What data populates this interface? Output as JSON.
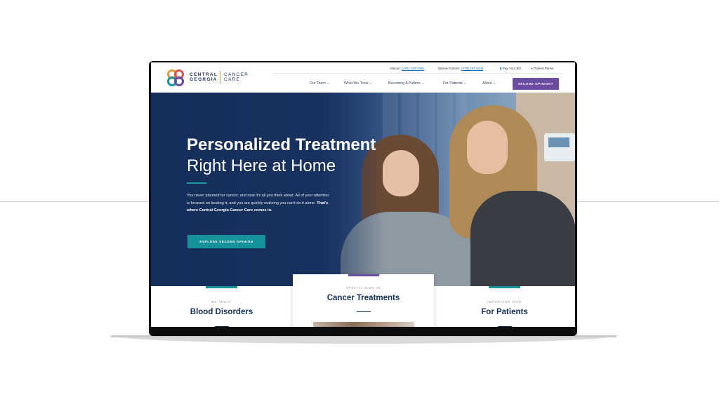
{
  "brand": {
    "name_line1": "CENTRAL",
    "name_line2": "GEORGIA",
    "sub_line1": "CANCER",
    "sub_line2": "CARE",
    "colors": {
      "navy": "#1b2f57",
      "teal": "#16929b",
      "purple": "#6a4ca0",
      "orange": "#e09a3c"
    }
  },
  "topbar": {
    "macon_label": "Macon:",
    "macon_phone": "(478) 743-7068",
    "warner_label": "Warner Robins:",
    "warner_phone": "(478) 287-6344",
    "pay_bill": "Pay Your Bill",
    "patient_portal": "Patient Portal",
    "pay_icon": "card-icon",
    "portal_icon": "user-icon"
  },
  "nav": {
    "items": [
      {
        "label": "Our Team"
      },
      {
        "label": "What We Treat"
      },
      {
        "label": "Becoming A Patient"
      },
      {
        "label": "For Patients"
      },
      {
        "label": "About"
      }
    ],
    "caret": "⌄",
    "cta": "SECOND OPINION?"
  },
  "hero": {
    "title": "Personalized Treatment",
    "subtitle": "Right Here at Home",
    "body_plain": "You never planned for cancer, and now it's all you think about. All of your attention is focused on beating it, and you are quickly realizing you can't do it alone. ",
    "body_bold": "That's where Central Georgia Cancer Care comes in.",
    "button": "EXPLORE SECOND OPINION"
  },
  "cards": [
    {
      "eyebrow": "WE TREAT",
      "title": "Blood Disorders"
    },
    {
      "eyebrow": "SPECIALIZING IN",
      "title": "Cancer Treatments"
    },
    {
      "eyebrow": "IMPORTANT INFO",
      "title": "For Patients"
    }
  ]
}
